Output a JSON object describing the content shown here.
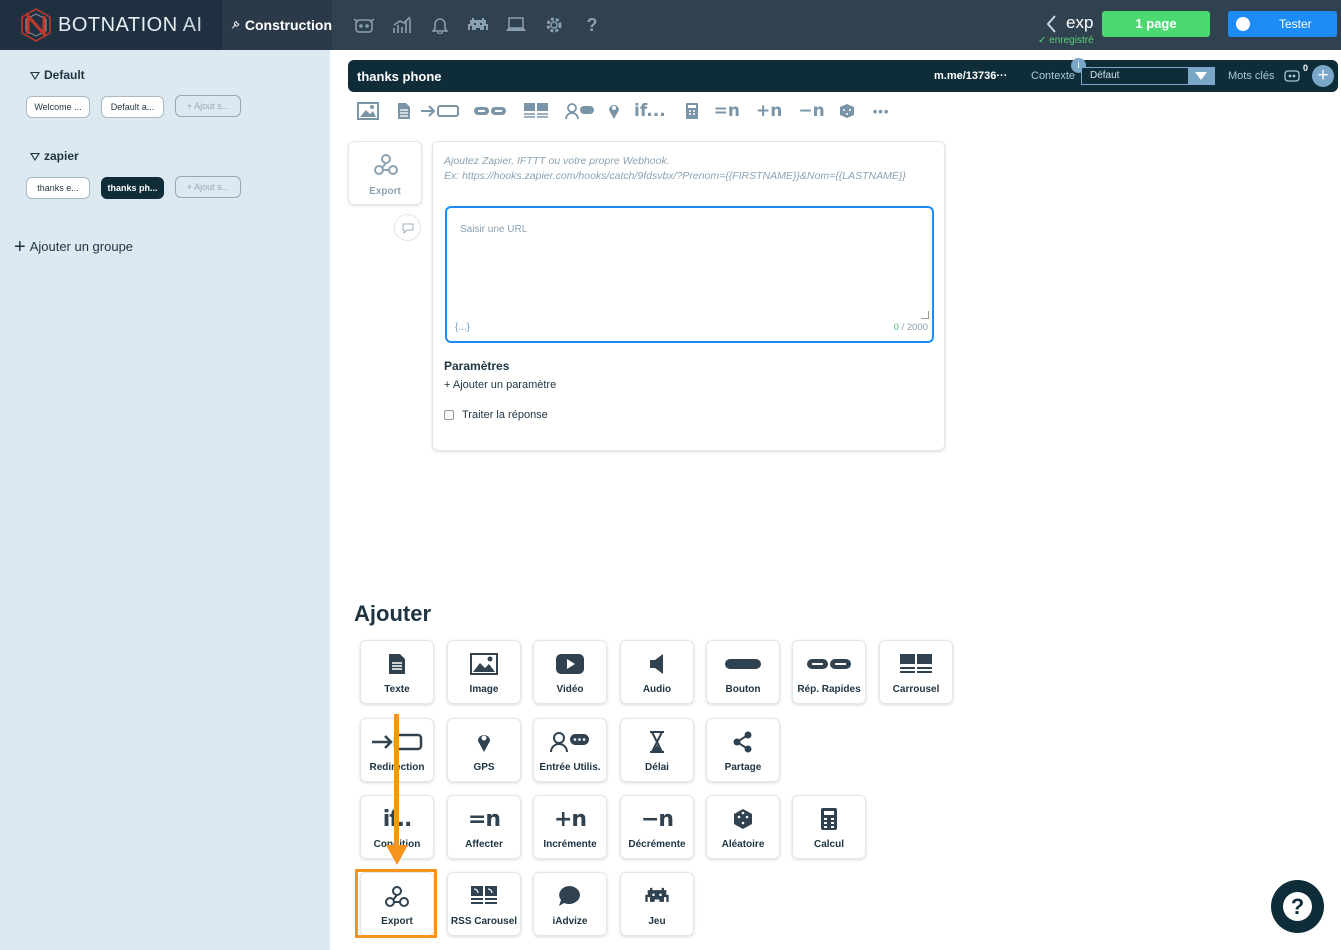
{
  "brand": {
    "name": "BOTNATION",
    "suffix": "AI"
  },
  "nav": {
    "construction": "Construction",
    "icons": [
      "robot-icon",
      "chart-icon",
      "bell-icon",
      "invader-icon",
      "laptop-icon",
      "gear-icon",
      "help-icon"
    ]
  },
  "bot": {
    "name": "exp",
    "status": "✓ enregistré"
  },
  "buttons": {
    "pages": "1 page",
    "test": "Tester"
  },
  "sidebar": {
    "groups": [
      {
        "title": "Default",
        "items": [
          "Welcome ...",
          "Default a...",
          "+ Ajout s..."
        ]
      },
      {
        "title": "zapier",
        "items": [
          "thanks e...",
          "thanks ph...",
          "+ Ajout s..."
        ]
      }
    ],
    "add_group": "Ajouter un groupe"
  },
  "header": {
    "title": "thanks phone",
    "link": "m.me/13736···",
    "context_label": "Contexte",
    "context_info": "i",
    "context_value": "Défaut",
    "keywords_label": "Mots clés",
    "keywords_count": "0"
  },
  "toolbar": {
    "if": "if...",
    "assign": "=n",
    "increment": "+n",
    "decrement": "−n",
    "more": "•••"
  },
  "export_card": {
    "label": "Export",
    "hint_line1": "Ajoutez Zapier, IFTTT ou votre propre Webhook.",
    "hint_line2": "Ex: https://hooks.zapier.com/hooks/catch/9fdsvbx/?Prenom={{FIRSTNAME}}&Nom={{LASTNAME}}",
    "url_placeholder": "Saisir une URL",
    "braces": "{...}",
    "char_count": "0",
    "char_max": " / 2000",
    "params_title": "Paramètres",
    "add_param": "+ Ajouter un paramètre",
    "treat_response": "Traiter la réponse"
  },
  "add_section": {
    "title": "Ajouter",
    "tiles": {
      "texte": "Texte",
      "image": "Image",
      "video": "Vidéo",
      "audio": "Audio",
      "bouton": "Bouton",
      "rep_rapides": "Rép. Rapides",
      "carrousel": "Carrousel",
      "redirection": "Redirection",
      "gps": "GPS",
      "entree": "Entrée Utilis.",
      "delai": "Délai",
      "partage": "Partage",
      "condition": "Condition",
      "affecter": "Affecter",
      "incremente": "Incrémente",
      "decremente": "Décrémente",
      "aleatoire": "Aléatoire",
      "calcul": "Calcul",
      "export": "Export",
      "rss": "RSS Carousel",
      "iadvize": "iAdvize",
      "jeu": "Jeu"
    },
    "glyphs": {
      "if": "if..",
      "assign": "=n",
      "increment": "+n",
      "decrement": "−n"
    }
  },
  "help": "?",
  "colors": {
    "accent": "#1e8cf6",
    "success": "#4cd870",
    "highlight": "#f7941d",
    "dark": "#0e2d38"
  }
}
